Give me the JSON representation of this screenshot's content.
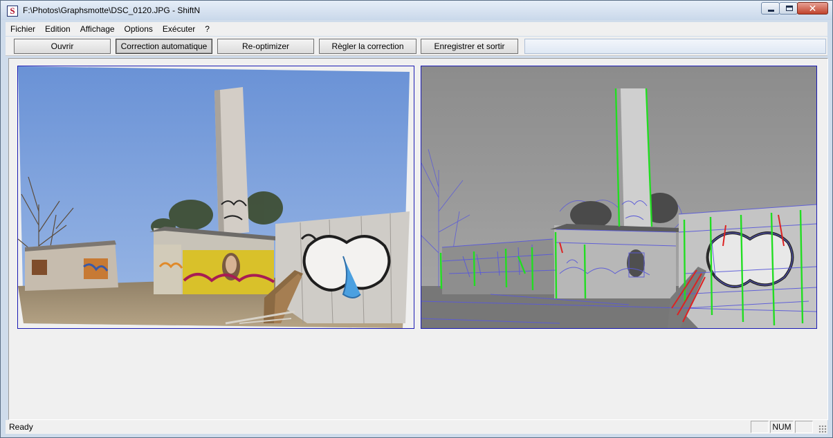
{
  "window": {
    "title": "F:\\Photos\\Graphsmotte\\DSC_0120.JPG - ShiftN",
    "icon_letter": "S",
    "close_glyph": "✕"
  },
  "menu": [
    "Fichier",
    "Edition",
    "Affichage",
    "Options",
    "Exécuter",
    "?"
  ],
  "toolbar": {
    "open": "Ouvrir",
    "auto_correct": "Correction automatique",
    "reoptimize": "Re-optimizer",
    "adjust": "Règler la correction",
    "save_exit": "Enregistrer et sortir"
  },
  "status": {
    "text": "Ready",
    "indicators": [
      "",
      "NUM",
      ""
    ]
  },
  "colors": {
    "panel_border": "#1a1ab4",
    "detected_vertical": "#22dd22",
    "detected_rejected": "#dd2222",
    "detected_edges": "#5a5ad8"
  }
}
